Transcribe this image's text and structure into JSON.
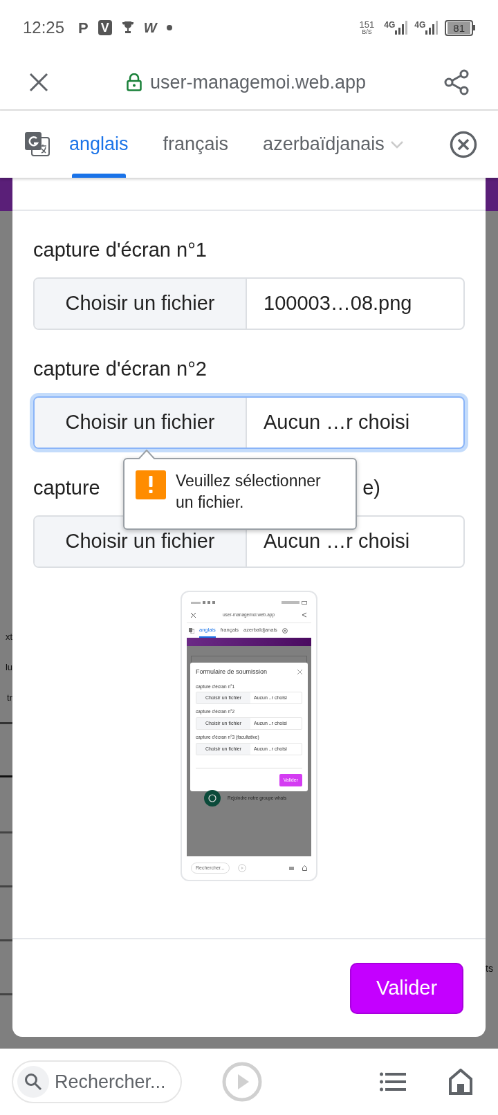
{
  "status_bar": {
    "time": "12:25",
    "notifications": [
      {
        "kind": "letter",
        "text": "P"
      },
      {
        "kind": "boxed",
        "text": "V"
      },
      {
        "kind": "trophy"
      },
      {
        "kind": "italic",
        "text": "W"
      },
      {
        "kind": "dot"
      }
    ],
    "net_speed": "151",
    "net_unit": "B/S",
    "signals": [
      "4G",
      "4G"
    ],
    "battery": "81"
  },
  "browser": {
    "url": "user-managemoi.web.app"
  },
  "translate_bar": {
    "tabs": [
      {
        "label": "anglais",
        "selected": true
      },
      {
        "label": "français",
        "selected": false
      },
      {
        "label": "azerbaïdjanais",
        "selected": false
      }
    ]
  },
  "background_fragments": {
    "left": [
      "xt",
      "lu",
      "tr"
    ],
    "right": [
      "ts"
    ]
  },
  "form": {
    "fields": [
      {
        "label": "capture d'écran n°1",
        "button": "Choisir un fichier",
        "value": "100003…08.png",
        "focused": false
      },
      {
        "label": "capture d'écran n°2",
        "button": "Choisir un fichier",
        "value": "Aucun …r choisi",
        "focused": true
      },
      {
        "label_parts": [
          "capture",
          "e)"
        ],
        "button": "Choisir un fichier",
        "value": "Aucun …r choisi",
        "focused": false
      }
    ],
    "tooltip": {
      "message": "Veuillez sélectionner un fichier."
    },
    "preview": {
      "url": "user-managemoi.web.app",
      "tabs": [
        {
          "label": "anglais",
          "selected": true
        },
        {
          "label": "français",
          "selected": false
        },
        {
          "label": "azerbaïdjanais",
          "selected": false
        }
      ],
      "title": "Formulaire de soumission",
      "fields": [
        {
          "label": "capture d'écran n°1",
          "button": "Choisir un fichier",
          "value": "Aucun ..r choisi"
        },
        {
          "label": "capture d'écran n°2",
          "button": "Choisir un fichier",
          "value": "Aucun ..r choisi"
        },
        {
          "label": "capture d'écran n°3 (facultative)",
          "button": "Choisir un fichier",
          "value": "Aucun ..r choisi"
        }
      ],
      "submit": "Valider",
      "join_text": "Rejoindre notre groupe whats",
      "search_placeholder": "Rechercher..."
    },
    "submit": "Valider"
  },
  "bottom_bar": {
    "search_placeholder": "Rechercher..."
  }
}
